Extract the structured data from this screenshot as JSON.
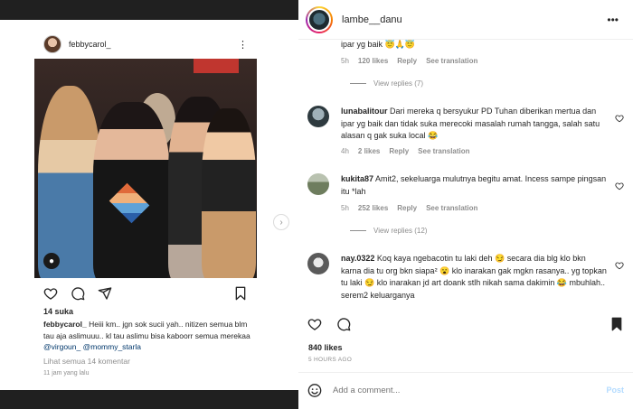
{
  "left_post": {
    "username": "febbycarol_",
    "menu_icon": "more-vertical-icon",
    "photo_sign": "",
    "likes": "14 suka",
    "caption_user": "febbycarol_",
    "caption_text": "Heiii km.. jgn sok sucii yah.. nitizen semua blm tau aja aslimuuu.. kl tau aslimu bisa kaboorr semua merekaa",
    "mention_1": "@virgoun_",
    "mention_2": "@mommy_starla",
    "view_comments": "Lihat semua 14 komentar",
    "time": "11 jam yang lalu"
  },
  "right_panel": {
    "username": "lambe__danu",
    "top_comment_tail": "ipar yg baik 😇🙏😇",
    "top_comment_meta": {
      "time": "5h",
      "likes": "120 likes",
      "reply": "Reply",
      "translate": "See translation"
    },
    "view_replies_1": "View replies (7)",
    "comments": [
      {
        "user": "lunabalitour",
        "text": "Dari mereka q bersyukur PD Tuhan diberikan mertua dan ipar yg baik dan tidak suka merecoki masalah rumah tangga, salah satu alasan q gak suka local 😂",
        "time": "4h",
        "likes": "2 likes",
        "reply": "Reply",
        "translate": "See translation"
      },
      {
        "user": "kukita87",
        "text": "Amit2, sekeluarga mulutnya begitu amat. Incess sampe pingsan itu *lah",
        "time": "5h",
        "likes": "252 likes",
        "reply": "Reply",
        "translate": "See translation"
      },
      {
        "user": "nay.0322",
        "text": "Koq kaya ngebacotin tu laki deh 😏 secara dia blg klo bkn karna dia tu org bkn siapa² 😮 klo inarakan gak mgkn rasanya.. yg topkan tu laki 😏 klo inarakan jd art doank stlh nikah sama dakimin 😂 mbuhlah.. serem2 keluarganya"
      }
    ],
    "view_replies_2": "View replies (12)",
    "likes": "840 likes",
    "time_ago": "5 HOURS AGO",
    "add_comment_placeholder": "Add a comment...",
    "post_label": "Post"
  },
  "colors": {
    "text": "#262626",
    "muted": "#8e8e8e",
    "link": "#00376b",
    "post_disabled": "#b3dbff"
  }
}
